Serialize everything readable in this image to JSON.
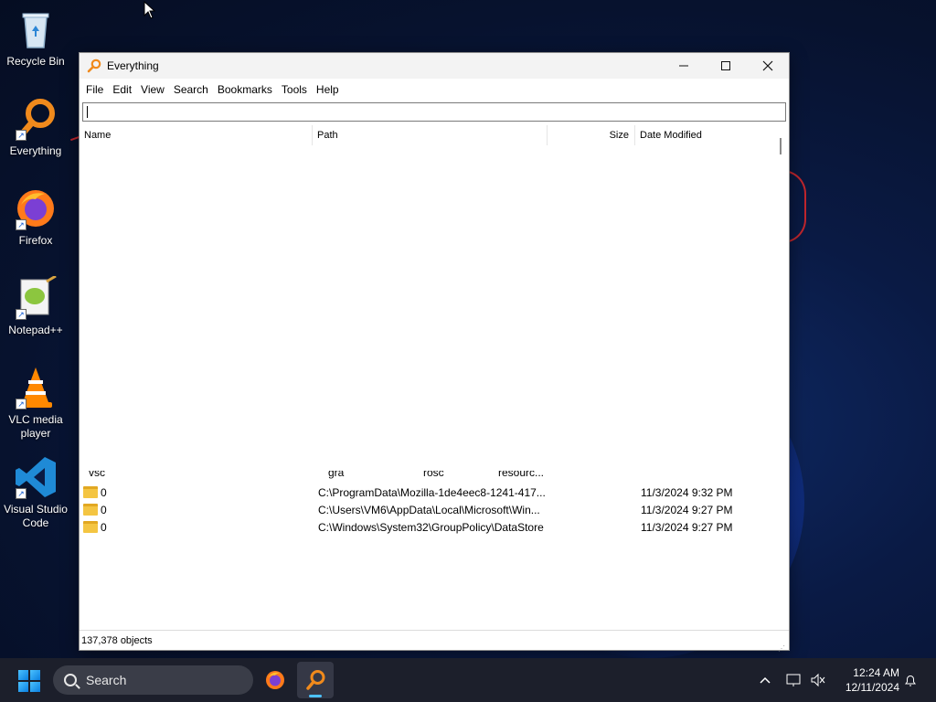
{
  "desktop": {
    "icons": [
      {
        "label": "Recycle Bin",
        "icon": "recycle-bin-icon"
      },
      {
        "label": "Everything",
        "icon": "everything-icon"
      },
      {
        "label": "Firefox",
        "icon": "firefox-icon"
      },
      {
        "label": "Notepad++",
        "icon": "notepadpp-icon"
      },
      {
        "label": "VLC media player",
        "icon": "vlc-icon"
      },
      {
        "label": "Visual Studio Code",
        "icon": "vscode-icon"
      }
    ]
  },
  "window": {
    "title": "Everything",
    "menu": [
      "File",
      "Edit",
      "View",
      "Search",
      "Bookmarks",
      "Tools",
      "Help"
    ],
    "search_value": "",
    "columns": {
      "name": "Name",
      "path": "Path",
      "size": "Size",
      "date": "Date Modified"
    },
    "partial_row": {
      "name": "vsc",
      "path_a": "gra",
      "path_b": "rosc",
      "path_c": "resourc..."
    },
    "rows": [
      {
        "name": "0",
        "path": "C:\\ProgramData\\Mozilla-1de4eec8-1241-417...",
        "size": "",
        "date": "11/3/2024 9:32 PM"
      },
      {
        "name": "0",
        "path": "C:\\Users\\VM6\\AppData\\Local\\Microsoft\\Win...",
        "size": "",
        "date": "11/3/2024 9:27 PM"
      },
      {
        "name": "0",
        "path": "C:\\Windows\\System32\\GroupPolicy\\DataStore",
        "size": "",
        "date": "11/3/2024 9:27 PM"
      }
    ],
    "status": "137,378 objects"
  },
  "taskbar": {
    "search_label": "Search",
    "time": "12:24 AM",
    "date": "12/11/2024",
    "accent": "#4cc2ff"
  }
}
